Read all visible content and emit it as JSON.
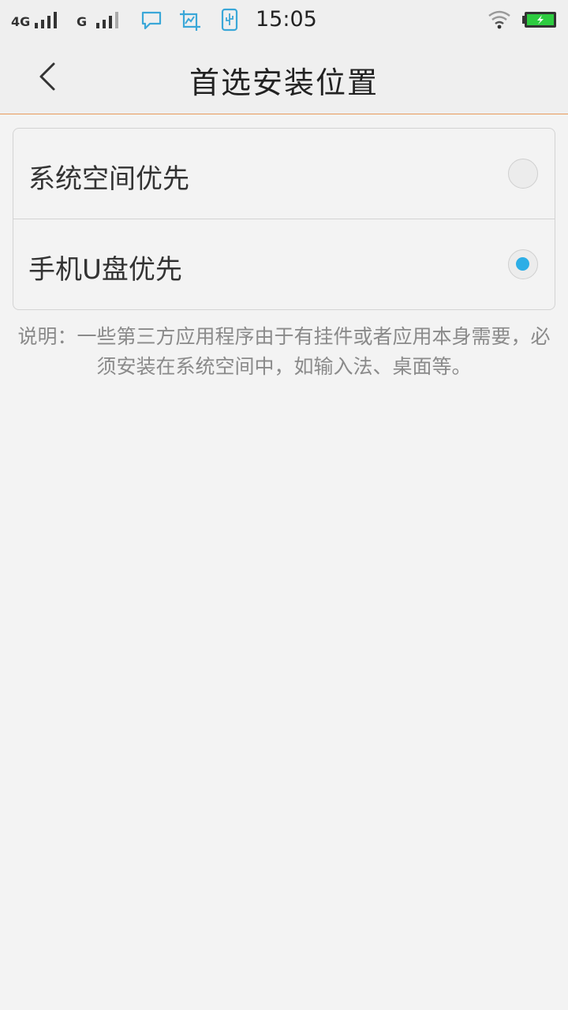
{
  "status_bar": {
    "network_1": "4G",
    "network_2": "G",
    "time": "15:05",
    "icons": [
      "signal-icon",
      "message-icon",
      "screenshot-icon",
      "usb-icon",
      "wifi-icon",
      "battery-charging-icon"
    ],
    "accent_color": "#3aa7d8",
    "battery_color": "#2ecc40"
  },
  "app_bar": {
    "title": "首选安装位置",
    "back_icon": "chevron-left-icon"
  },
  "options": [
    {
      "label": "系统空间优先",
      "selected": false
    },
    {
      "label": "手机U盘优先",
      "selected": true
    }
  ],
  "note": "说明：一些第三方应用程序由于有挂件或者应用本身需要，必须安装在系统空间中，如输入法、桌面等。",
  "colors": {
    "radio_selected": "#2daee6",
    "divider_accent": "#e89a5a"
  }
}
